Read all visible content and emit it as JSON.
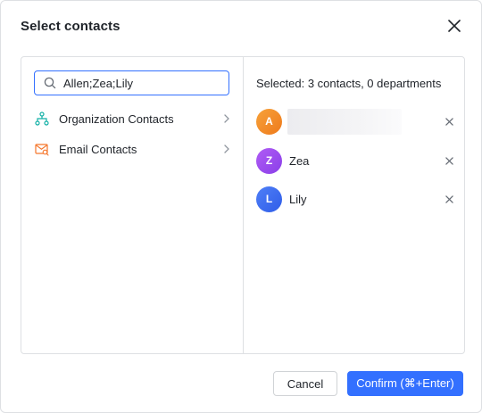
{
  "dialog": {
    "title": "Select contacts"
  },
  "search": {
    "value": "Allen;Zea;Lily"
  },
  "nav": {
    "items": [
      {
        "label": "Organization Contacts",
        "icon": "org-tree-icon"
      },
      {
        "label": "Email Contacts",
        "icon": "email-contact-icon"
      }
    ]
  },
  "selected": {
    "summary": "Selected: 3 contacts, 0 departments",
    "contacts": [
      {
        "initial": "A",
        "name": "",
        "avatar_color": "#f08a24"
      },
      {
        "initial": "Z",
        "name": "Zea",
        "avatar_color": "#9a4cf0"
      },
      {
        "initial": "L",
        "name": "Lily",
        "avatar_color": "#3f6df2"
      }
    ]
  },
  "footer": {
    "cancel_label": "Cancel",
    "confirm_label": "Confirm (⌘+Enter)"
  },
  "colors": {
    "accent": "#3370ff",
    "border": "#dee0e3"
  }
}
